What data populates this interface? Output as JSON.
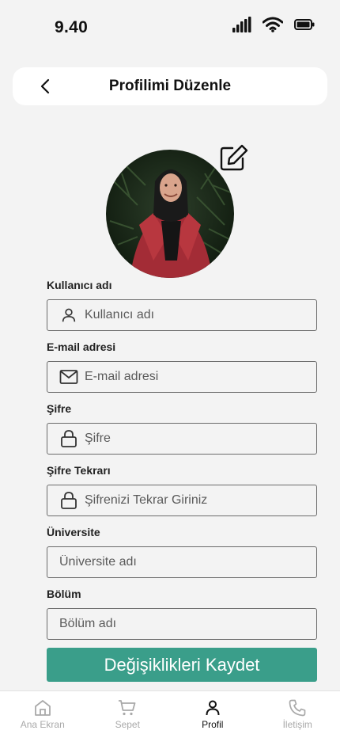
{
  "status_bar": {
    "time": "9.40"
  },
  "header": {
    "title": "Profilimi Düzenle"
  },
  "form": {
    "fields": [
      {
        "label": "Kullanıcı adı",
        "placeholder": "Kullanıcı adı",
        "icon": "user-icon"
      },
      {
        "label": "E-mail adresi",
        "placeholder": "E-mail adresi",
        "icon": "mail-icon"
      },
      {
        "label": "Şifre",
        "placeholder": "Şifre",
        "icon": "lock-icon"
      },
      {
        "label": "Şifre Tekrarı",
        "placeholder": "Şifrenizi Tekrar Giriniz",
        "icon": "lock-icon"
      },
      {
        "label": "Üniversite",
        "placeholder": "Üniversite adı",
        "icon": ""
      },
      {
        "label": "Bölüm",
        "placeholder": "Bölüm adı",
        "icon": ""
      }
    ],
    "save_label": "Değişiklikleri Kaydet"
  },
  "bottom_nav": {
    "items": [
      {
        "label": "Ana Ekran",
        "icon": "home-icon",
        "active": false
      },
      {
        "label": "Sepet",
        "icon": "cart-icon",
        "active": false
      },
      {
        "label": "Profil",
        "icon": "user-icon",
        "active": true
      },
      {
        "label": "İletişim",
        "icon": "phone-icon",
        "active": false
      }
    ]
  },
  "colors": {
    "accent": "#3a9e8a",
    "background": "#f3f3f3",
    "inactive_nav": "#a9a9a9"
  }
}
